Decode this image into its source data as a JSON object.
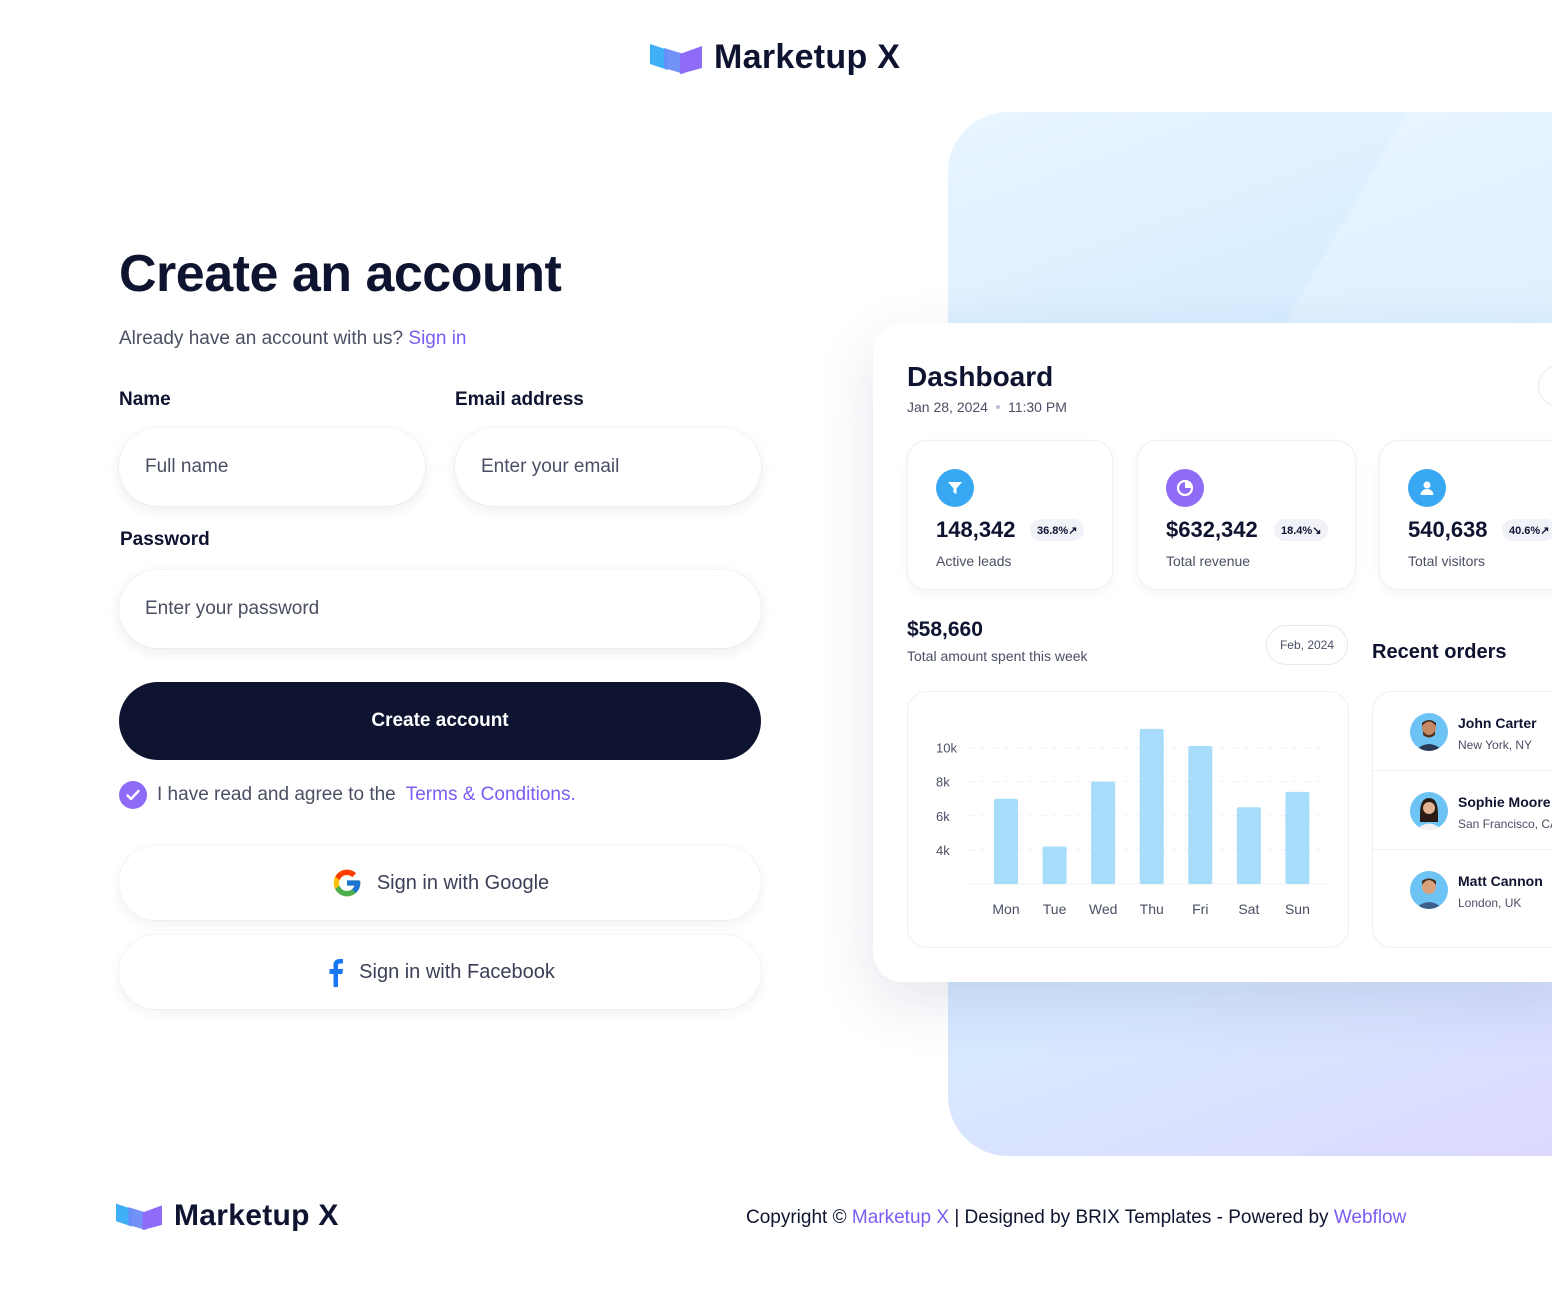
{
  "brand": {
    "name": "Marketup X"
  },
  "form": {
    "title": "Create an account",
    "subtitle_prefix": "Already have an account with us?",
    "signin_link": "Sign in",
    "name_label": "Name",
    "name_placeholder": "Full name",
    "email_label": "Email address",
    "email_placeholder": "Enter your email",
    "password_label": "Password",
    "password_placeholder": "Enter your password",
    "submit_label": "Create account",
    "agree_prefix": "I have read and agree to the",
    "terms_link": "Terms & Conditions.",
    "terms_checked": true,
    "google_label": "Sign in with Google",
    "facebook_label": "Sign in with Facebook"
  },
  "dashboard": {
    "title": "Dashboard",
    "date": "Jan 28, 2024",
    "time": "11:30 PM",
    "stats": [
      {
        "value": "148,342",
        "change": "36.8%↗",
        "label": "Active leads",
        "icon": "funnel-icon",
        "color": "#38a8f2"
      },
      {
        "value": "$632,342",
        "change": "18.4%↘",
        "label": "Total revenue",
        "icon": "pie-chart-icon",
        "color": "#8f6cf7"
      },
      {
        "value": "540,638",
        "change": "40.6%↗",
        "label": "Total visitors",
        "icon": "user-icon",
        "color": "#38a8f2"
      }
    ],
    "spend_value": "$58,660",
    "spend_label": "Total amount spent this week",
    "month": "Feb, 2024",
    "recent_title": "Recent orders",
    "orders": [
      {
        "name": "John Carter",
        "location": "New York, NY"
      },
      {
        "name": "Sophie Moore",
        "location": "San Francisco, CA"
      },
      {
        "name": "Matt Cannon",
        "location": "London, UK"
      }
    ]
  },
  "chart_data": {
    "type": "bar",
    "categories": [
      "Mon",
      "Tue",
      "Wed",
      "Thu",
      "Fri",
      "Sat",
      "Sun"
    ],
    "values": [
      7000,
      4200,
      8000,
      11100,
      10100,
      6500,
      7400
    ],
    "yticks": [
      "10k",
      "8k",
      "6k",
      "4k"
    ],
    "ylim": [
      2000,
      11500
    ],
    "bar_color": "#a7dcfb"
  },
  "footer": {
    "copyright_prefix": "Copyright ©",
    "brand_link": "Marketup X",
    "middle": "| Designed by BRIX Templates - Powered by",
    "webflow_link": "Webflow"
  }
}
